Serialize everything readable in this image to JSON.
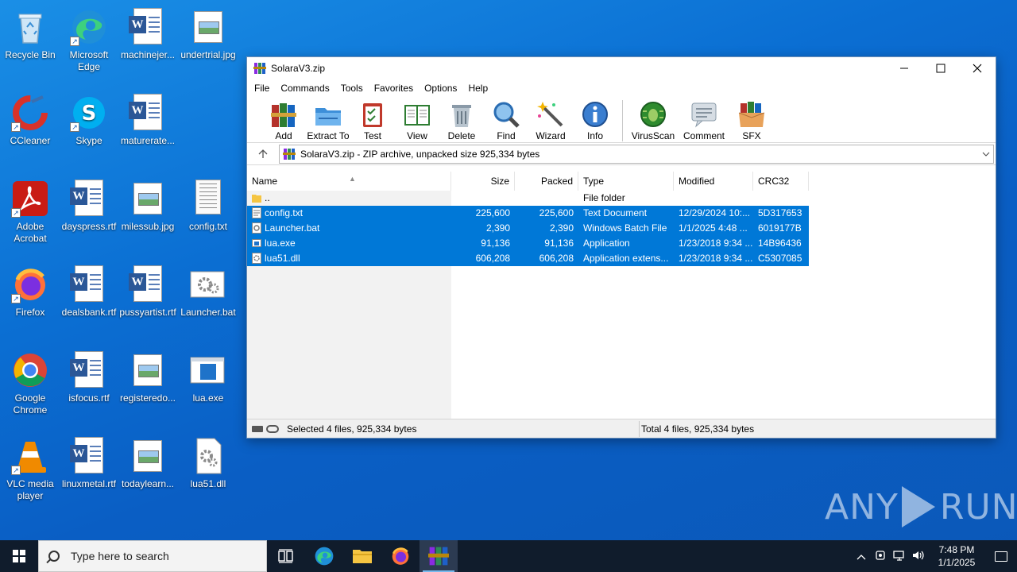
{
  "desktop": {
    "icons": [
      {
        "label": "Recycle Bin"
      },
      {
        "label": "Microsoft Edge"
      },
      {
        "label": "machinejer..."
      },
      {
        "label": "undertrial.jpg"
      },
      {
        "label": "CCleaner"
      },
      {
        "label": "Skype"
      },
      {
        "label": "maturerate..."
      },
      {
        "label": "Adobe Acrobat"
      },
      {
        "label": "dayspress.rtf"
      },
      {
        "label": "milessub.jpg"
      },
      {
        "label": "config.txt"
      },
      {
        "label": "Firefox"
      },
      {
        "label": "dealsbank.rtf"
      },
      {
        "label": "pussyartist.rtf"
      },
      {
        "label": "Launcher.bat"
      },
      {
        "label": "Google Chrome"
      },
      {
        "label": "isfocus.rtf"
      },
      {
        "label": "registeredo..."
      },
      {
        "label": "lua.exe"
      },
      {
        "label": "VLC media player"
      },
      {
        "label": "linuxmetal.rtf"
      },
      {
        "label": "todaylearn..."
      },
      {
        "label": "lua51.dll"
      }
    ]
  },
  "window": {
    "title": "SolaraV3.zip",
    "menu": [
      "File",
      "Commands",
      "Tools",
      "Favorites",
      "Options",
      "Help"
    ],
    "toolbar": [
      "Add",
      "Extract To",
      "Test",
      "View",
      "Delete",
      "Find",
      "Wizard",
      "Info",
      "VirusScan",
      "Comment",
      "SFX"
    ],
    "address": "SolaraV3.zip - ZIP archive, unpacked size 925,334 bytes",
    "columns": {
      "name": "Name",
      "size": "Size",
      "packed": "Packed",
      "type": "Type",
      "modified": "Modified",
      "crc": "CRC32"
    },
    "rows": [
      {
        "name": "..",
        "size": "",
        "packed": "",
        "type": "File folder",
        "modified": "",
        "crc": "",
        "selected": false
      },
      {
        "name": "config.txt",
        "size": "225,600",
        "packed": "225,600",
        "type": "Text Document",
        "modified": "12/29/2024 10:...",
        "crc": "5D317653",
        "selected": true
      },
      {
        "name": "Launcher.bat",
        "size": "2,390",
        "packed": "2,390",
        "type": "Windows Batch File",
        "modified": "1/1/2025 4:48 ...",
        "crc": "6019177B",
        "selected": true
      },
      {
        "name": "lua.exe",
        "size": "91,136",
        "packed": "91,136",
        "type": "Application",
        "modified": "1/23/2018 9:34 ...",
        "crc": "14B96436",
        "selected": true
      },
      {
        "name": "lua51.dll",
        "size": "606,208",
        "packed": "606,208",
        "type": "Application extens...",
        "modified": "1/23/2018 9:34 ...",
        "crc": "C5307085",
        "selected": true
      }
    ],
    "status_left": "Selected 4 files, 925,334 bytes",
    "status_right": "Total 4 files, 925,334 bytes"
  },
  "watermark": {
    "left": "ANY",
    "right": "RUN"
  },
  "taskbar": {
    "search_placeholder": "Type here to search",
    "time": "7:48 PM",
    "date": "1/1/2025"
  },
  "colors": {
    "selection": "#0078d7",
    "taskbar": "#101c2c",
    "desktop": "#0b6fd3"
  }
}
